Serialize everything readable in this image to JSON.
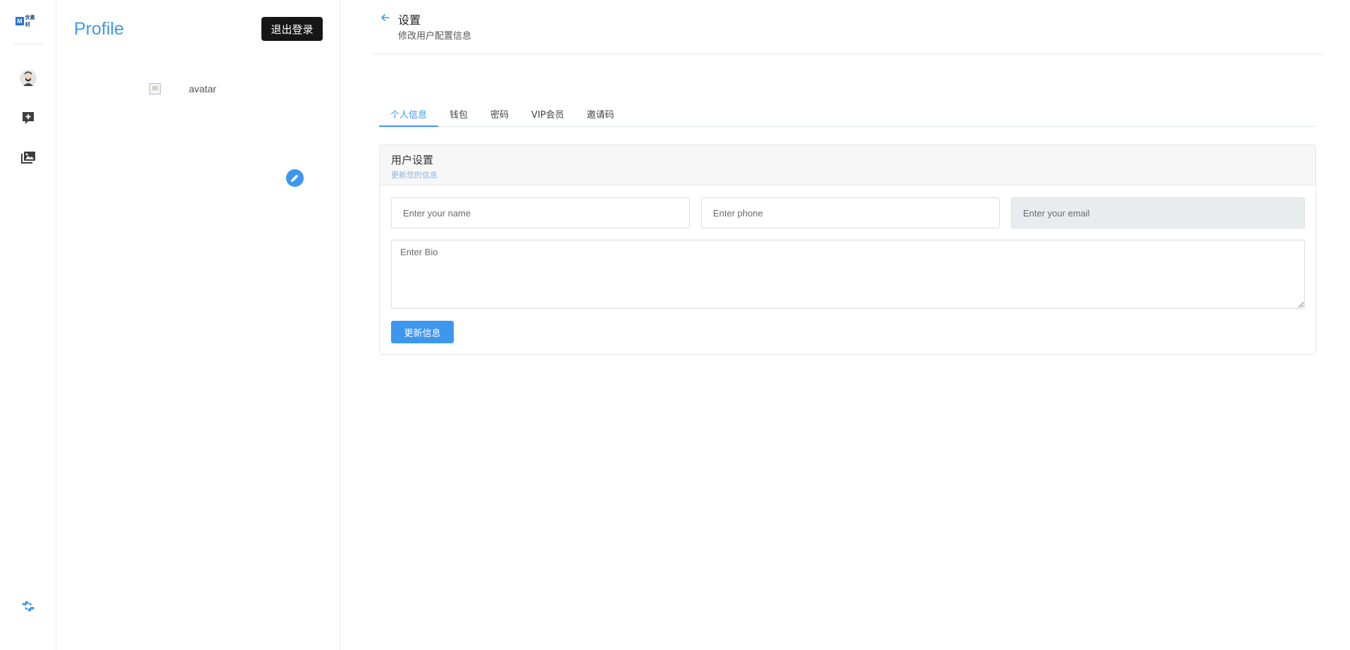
{
  "rail": {
    "logo_text": "优素材",
    "logo_letter": "M",
    "items": [
      {
        "name": "avatar-nav",
        "icon": "user-avatar-icon"
      },
      {
        "name": "add-post",
        "icon": "add-box-icon"
      },
      {
        "name": "gallery",
        "icon": "photo-library-icon"
      }
    ],
    "settings_icon": "gear-icon"
  },
  "profile": {
    "title": "Profile",
    "logout_label": "退出登录",
    "avatar_alt": "avatar"
  },
  "header": {
    "title": "设置",
    "subtitle": "修改用户配置信息"
  },
  "tabs": [
    {
      "label": "个人信息",
      "active": true
    },
    {
      "label": "钱包",
      "active": false
    },
    {
      "label": "密码",
      "active": false
    },
    {
      "label": "VIP会员",
      "active": false
    },
    {
      "label": "邀请码",
      "active": false
    }
  ],
  "card": {
    "title": "用户设置",
    "subtitle": "更新您的信息",
    "name_placeholder": "Enter your name",
    "phone_placeholder": "Enter phone",
    "email_placeholder": "Enter your email",
    "bio_placeholder": "Enter Bio",
    "submit_label": "更新信息"
  },
  "colors": {
    "accent": "#3e97ef",
    "dark_button": "#161616"
  }
}
